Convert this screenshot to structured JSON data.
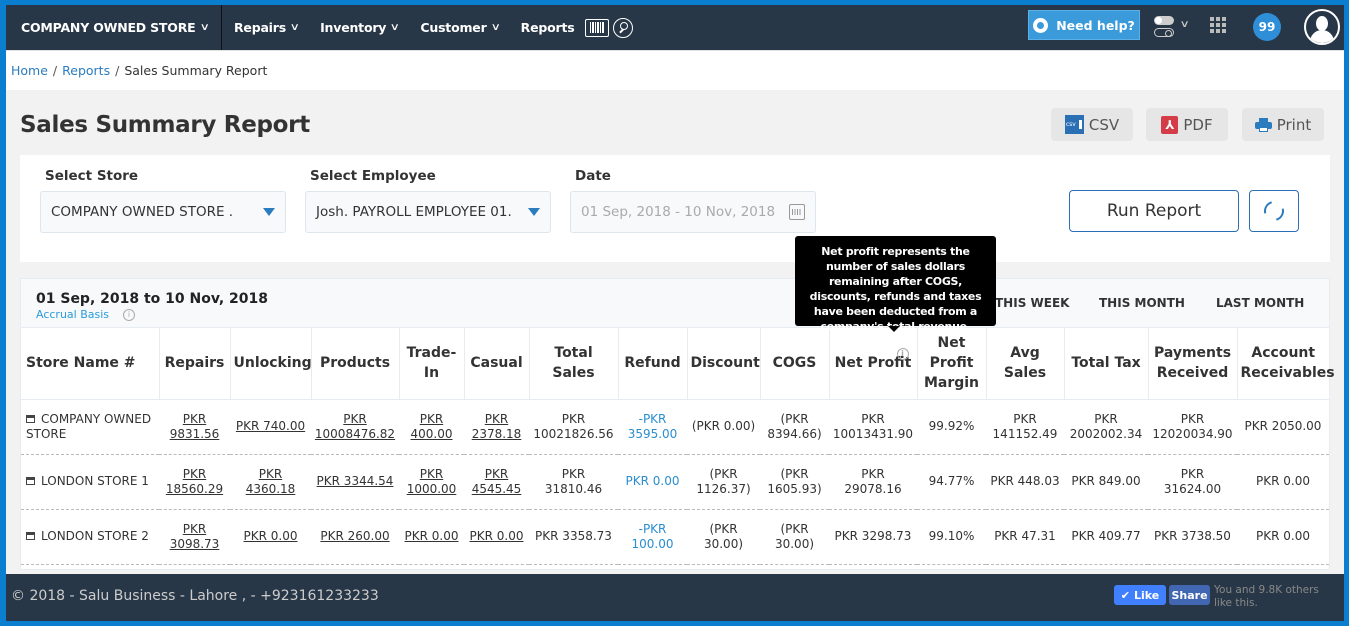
{
  "nav": {
    "store": "COMPANY OWNED STORE",
    "items": [
      "Repairs",
      "Inventory",
      "Customer",
      "Reports"
    ],
    "help": "Need help?",
    "notifications": "99"
  },
  "breadcrumb": {
    "home": "Home",
    "reports": "Reports",
    "current": "Sales Summary Report"
  },
  "page": {
    "title": "Sales Summary Report",
    "export": {
      "csv": "CSV",
      "pdf": "PDF",
      "print": "Print"
    }
  },
  "filters": {
    "store_label": "Select Store",
    "store_value": "COMPANY OWNED STORE .",
    "employee_label": "Select Employee",
    "employee_value": "Josh. PAYROLL EMPLOYEE 01.",
    "date_label": "Date",
    "date_value": "01 Sep, 2018 - 10 Nov, 2018",
    "run": "Run Report"
  },
  "report": {
    "range": "01 Sep, 2018 to 10 Nov, 2018",
    "basis": "Accrual Basis",
    "periods": [
      "THIS WEEK",
      "THIS MONTH",
      "LAST MONTH"
    ],
    "tooltip": "Net profit represents the number of sales dollars remaining after COGS, discounts, refunds and taxes have been deducted from a company's total revenue.",
    "columns": [
      "Store Name #",
      "Repairs",
      "Unlocking",
      "Products",
      "Trade-In",
      "Casual",
      "Total Sales",
      "Refund",
      "Discount",
      "COGS",
      "Net Profit",
      "Net Profit Margin",
      "Avg Sales",
      "Total Tax",
      "Payments Received",
      "Account Receivables"
    ],
    "rows": [
      [
        "COMPANY OWNED STORE",
        "PKR 9831.56",
        "PKR 740.00",
        "PKR 10008476.82",
        "PKR 400.00",
        "PKR 2378.18",
        "PKR 10021826.56",
        "-PKR 3595.00",
        "(PKR 0.00)",
        "(PKR 8394.66)",
        "PKR 10013431.90",
        "99.92%",
        "PKR 141152.49",
        "PKR 2002002.34",
        "PKR 12020034.90",
        "PKR 2050.00"
      ],
      [
        "LONDON STORE 1",
        "PKR 18560.29",
        "PKR 4360.18",
        "PKR 3344.54",
        "PKR 1000.00",
        "PKR 4545.45",
        "PKR 31810.46",
        "PKR 0.00",
        "(PKR 1126.37)",
        "(PKR 1605.93)",
        "PKR 29078.16",
        "94.77%",
        "PKR 448.03",
        "PKR 849.00",
        "PKR 31624.00",
        "PKR 0.00"
      ],
      [
        "LONDON STORE 2",
        "PKR 3098.73",
        "PKR 0.00",
        "PKR 260.00",
        "PKR 0.00",
        "PKR 0.00",
        "PKR 3358.73",
        "-PKR 100.00",
        "(PKR 30.00)",
        "(PKR 30.00)",
        "PKR 3298.73",
        "99.10%",
        "PKR 47.31",
        "PKR 409.77",
        "PKR 3738.50",
        "PKR 0.00"
      ]
    ]
  },
  "footer": {
    "copyright": "© 2018 - Salu Business - Lahore , - +923161233233",
    "like": "Like",
    "share": "Share",
    "social_text": "You and 9.8K others like this."
  }
}
